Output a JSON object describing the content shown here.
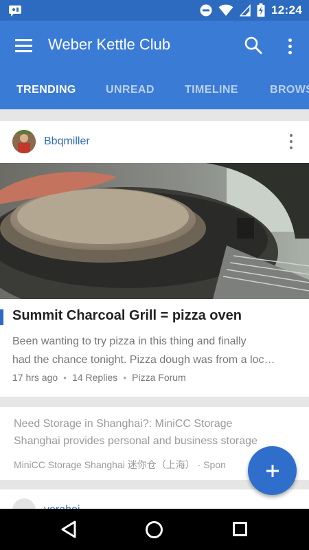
{
  "status_bar": {
    "time": "12:24",
    "icons": [
      "notification-icon",
      "do-not-disturb-icon",
      "wifi-icon",
      "signal-icon",
      "battery-charging-icon"
    ]
  },
  "app_bar": {
    "title": "Weber Kettle Club",
    "icons": [
      "menu-icon",
      "search-icon",
      "more-vert-icon"
    ]
  },
  "tabs": [
    {
      "label": "TRENDING",
      "active": true
    },
    {
      "label": "UNREAD",
      "active": false
    },
    {
      "label": "TIMELINE",
      "active": false
    },
    {
      "label": "BROWS",
      "active": false
    }
  ],
  "posts": [
    {
      "author": "Bbqmiller",
      "title": "Summit Charcoal Grill = pizza oven",
      "excerpt_line1": "Been wanting to try pizza in this thing and finally",
      "excerpt_line2": "had the chance tonight. Pizza dough was from a loc…",
      "time": "17 hrs ago",
      "replies": "14 Replies",
      "forum": "Pizza Forum"
    }
  ],
  "ad": {
    "line1": "Need Storage in Shanghai?: MiniCC Storage",
    "line2": "Shanghai provides personal and business storage",
    "meta": "MiniCC Storage Shanghai 迷你仓（上海） · Spon"
  },
  "next_post": {
    "author": "yerahoi"
  },
  "colors": {
    "app_bar": "#3a7bd5",
    "status_bar": "#2c6bc0",
    "accent": "#2f6fcb",
    "link": "#2f6db8"
  }
}
